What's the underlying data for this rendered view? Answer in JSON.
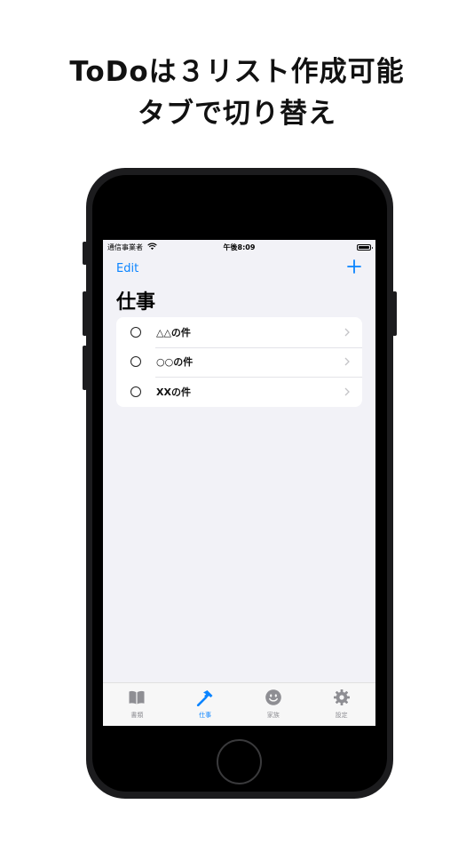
{
  "headline": {
    "line1": "ToDoは３リスト作成可能",
    "line2": "タブで切り替え"
  },
  "status_bar": {
    "carrier": "通信事業者",
    "time": "午後8:09"
  },
  "nav": {
    "edit_label": "Edit",
    "add_icon": "plus-icon"
  },
  "page_title": "仕事",
  "todo_items": [
    {
      "label": "△△の件",
      "completed": false
    },
    {
      "label": "○○の件",
      "completed": false
    },
    {
      "label": "XXの件",
      "completed": false
    }
  ],
  "tabs": [
    {
      "label": "書類",
      "icon": "book-icon",
      "active": false
    },
    {
      "label": "仕事",
      "icon": "hammer-icon",
      "active": true
    },
    {
      "label": "家族",
      "icon": "smiley-icon",
      "active": false
    },
    {
      "label": "設定",
      "icon": "gear-icon",
      "active": false
    }
  ],
  "colors": {
    "accent": "#0a84ff",
    "inactive": "#8e8e93",
    "background": "#f2f2f7"
  }
}
